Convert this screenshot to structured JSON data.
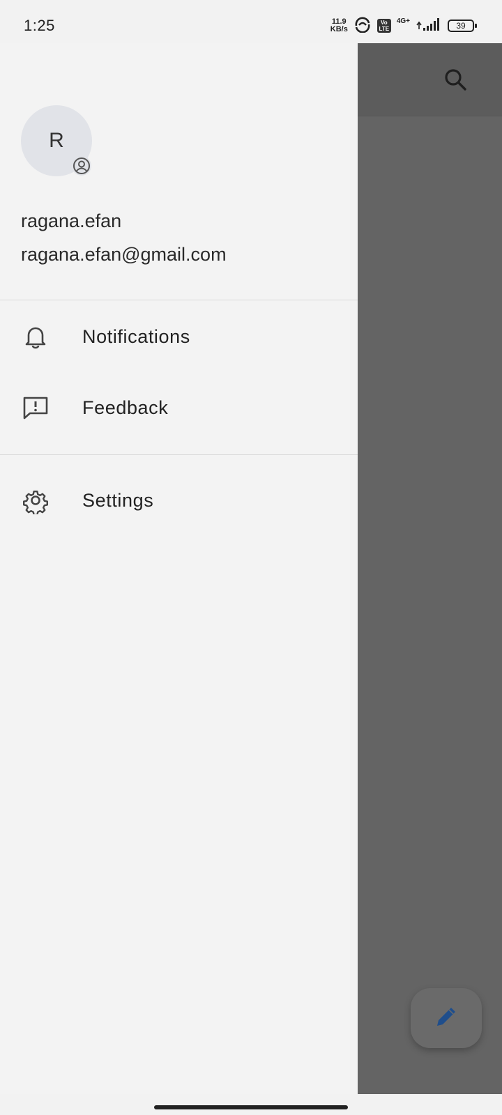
{
  "status_bar": {
    "time": "1:25",
    "net_speed_value": "11.9",
    "net_speed_unit": "KB/s",
    "volte_top": "Vo",
    "volte_bottom": "LTE",
    "network_type": "4G+",
    "battery": "39"
  },
  "drawer": {
    "avatar_initial": "R",
    "username": "ragana.efan",
    "email": "ragana.efan@gmail.com",
    "items": [
      {
        "label": "Notifications",
        "icon": "bell-icon"
      },
      {
        "label": "Feedback",
        "icon": "feedback-icon"
      },
      {
        "label": "Settings",
        "icon": "gear-icon"
      }
    ]
  },
  "background_app": {
    "search_icon": "search-icon",
    "fab_icon": "pencil-icon"
  },
  "colors": {
    "scrim": "#646464",
    "drawer_bg": "#f3f3f3",
    "fab_icon": "#1f4e8c"
  }
}
